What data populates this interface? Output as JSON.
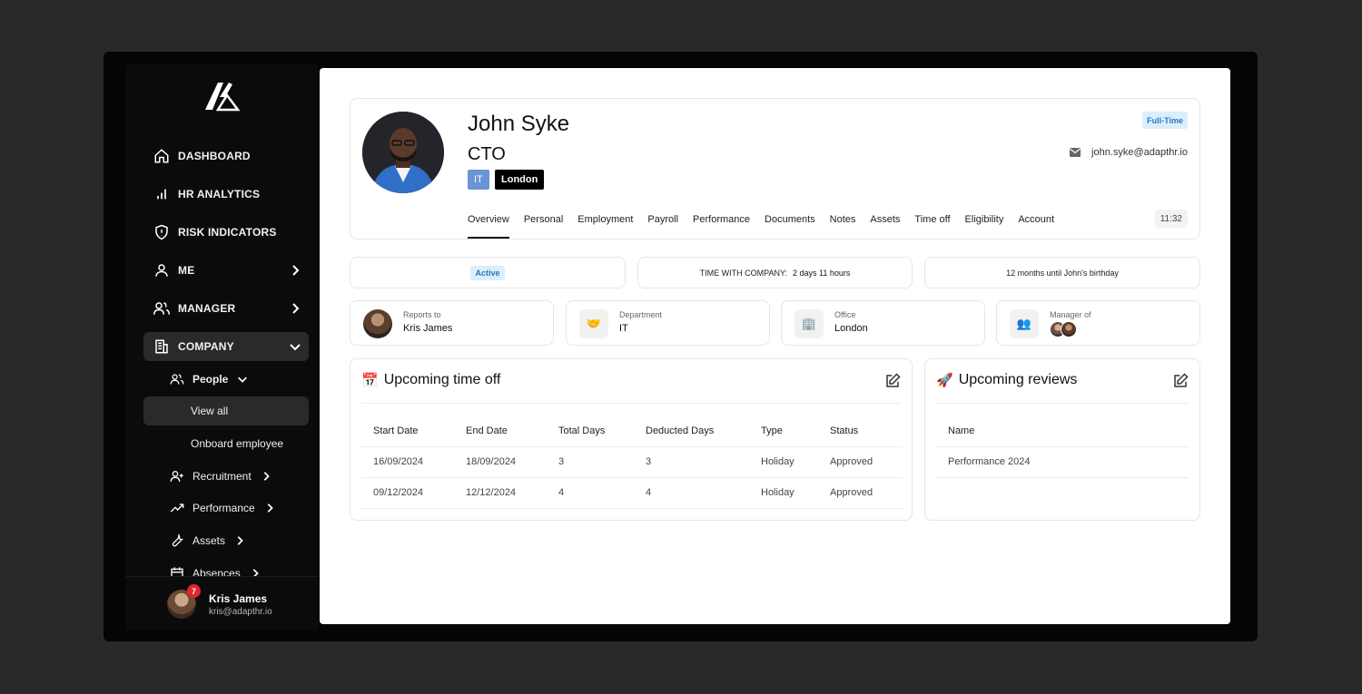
{
  "sidebar": {
    "items": [
      {
        "label": "DASHBOARD",
        "icon": "home-icon"
      },
      {
        "label": "HR ANALYTICS",
        "icon": "bar-chart-icon"
      },
      {
        "label": "RISK INDICATORS",
        "icon": "shield-icon"
      },
      {
        "label": "ME",
        "icon": "user-icon"
      },
      {
        "label": "MANAGER",
        "icon": "users-icon"
      },
      {
        "label": "COMPANY",
        "icon": "building-icon"
      }
    ],
    "sub": {
      "people": "People",
      "view_all": "View all",
      "onboard": "Onboard employee",
      "recruitment": "Recruitment",
      "performance": "Performance",
      "assets": "Assets",
      "absences": "Absences"
    },
    "user": {
      "name": "Kris James",
      "email": "kris@adapthr.io",
      "notifications": "7"
    }
  },
  "profile": {
    "name": "John Syke",
    "title": "CTO",
    "department_tag": "IT",
    "location_tag": "London",
    "employment_type": "Full-Time",
    "email": "john.syke@adapthr.io",
    "time": "11:32",
    "tabs": [
      "Overview",
      "Personal",
      "Employment",
      "Payroll",
      "Performance",
      "Documents",
      "Notes",
      "Assets",
      "Time off",
      "Eligibility",
      "Account"
    ]
  },
  "stats": {
    "status": "Active",
    "time_label": "TIME WITH COMPANY:",
    "time_value": "2 days 11 hours",
    "birthday": "12 months until John's birthday"
  },
  "info": {
    "reports_to_label": "Reports to",
    "reports_to": "Kris James",
    "department_label": "Department",
    "department": "IT",
    "office_label": "Office",
    "office": "London",
    "manager_of_label": "Manager of"
  },
  "time_off": {
    "title": "Upcoming time off",
    "columns": [
      "Start Date",
      "End Date",
      "Total Days",
      "Deducted Days",
      "Type",
      "Status"
    ],
    "rows": [
      [
        "16/09/2024",
        "18/09/2024",
        "3",
        "3",
        "Holiday",
        "Approved"
      ],
      [
        "09/12/2024",
        "12/12/2024",
        "4",
        "4",
        "Holiday",
        "Approved"
      ]
    ]
  },
  "reviews": {
    "title": "Upcoming reviews",
    "column": "Name",
    "rows": [
      "Performance 2024"
    ]
  },
  "colors": {
    "accent_blue": "#6a94d4",
    "status_bg": "#dbeefc",
    "status_fg": "#2b79b8",
    "badge_red": "#e0262b"
  }
}
